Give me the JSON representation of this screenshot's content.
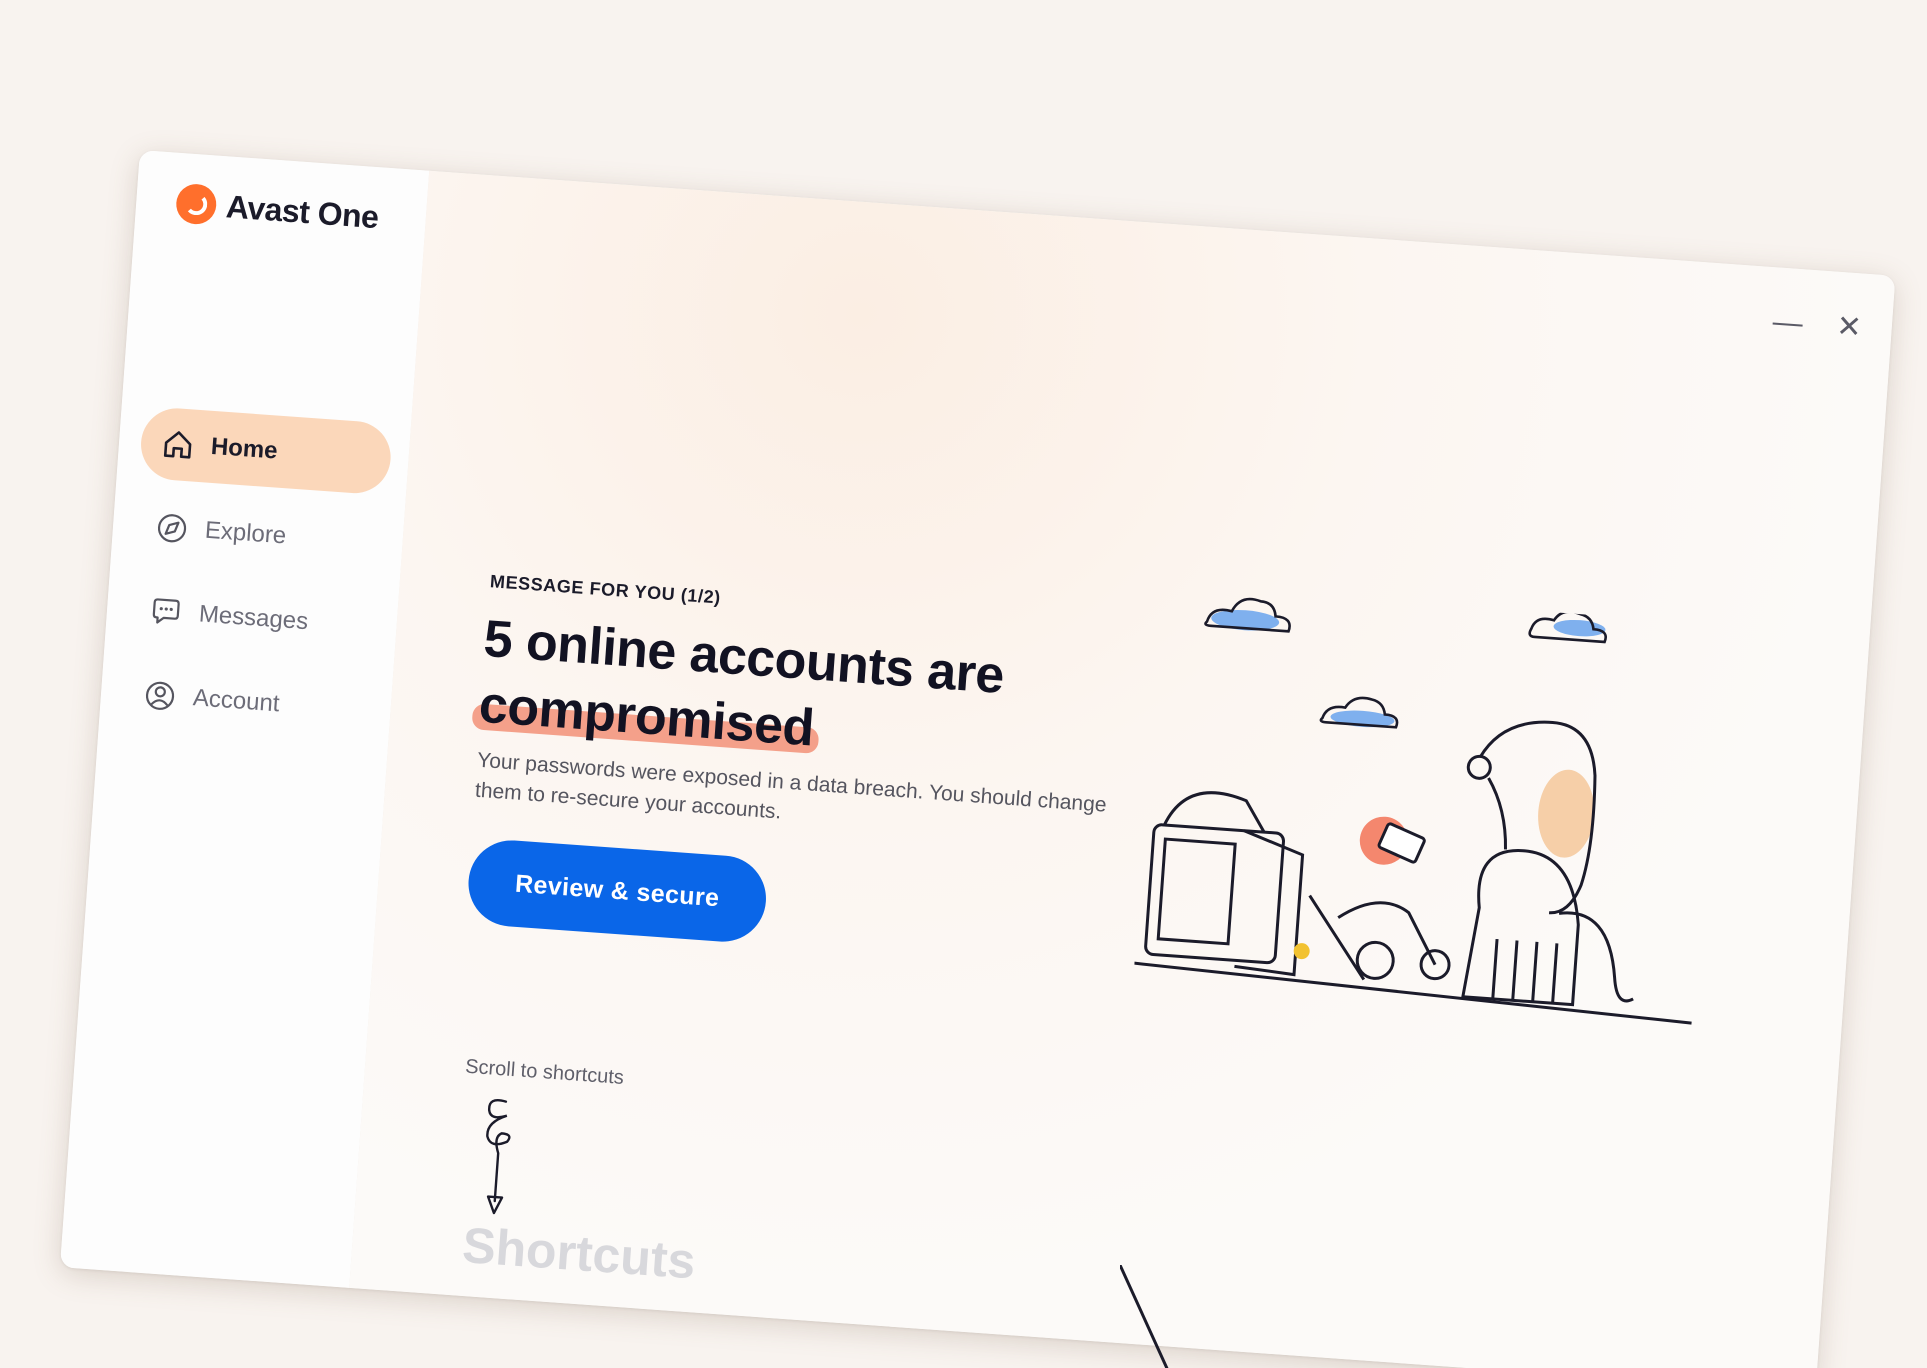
{
  "app": {
    "name": "Avast One",
    "logo_icon": "avast-logo-icon",
    "brand_color": "#ff6f2c"
  },
  "window_controls": {
    "minimize": "—",
    "close": "✕"
  },
  "sidebar": {
    "items": [
      {
        "label": "Home",
        "icon": "home-icon",
        "active": true
      },
      {
        "label": "Explore",
        "icon": "compass-icon",
        "active": false
      },
      {
        "label": "Messages",
        "icon": "chat-bubble-icon",
        "active": false
      },
      {
        "label": "Account",
        "icon": "user-circle-icon",
        "active": false
      }
    ]
  },
  "message": {
    "label": "MESSAGE FOR YOU (1/2)",
    "headline_part1": "5 online accounts are",
    "headline_highlight": "compromised",
    "body": "Your passwords were exposed in a data breach. You should change them to re-secure your accounts.",
    "cta_label": "Review & secure",
    "cta_color": "#0a66e8",
    "highlight_color": "#f4a08a"
  },
  "scroll_hint": "Scroll to shortcuts",
  "shortcuts_heading": "Shortcuts"
}
